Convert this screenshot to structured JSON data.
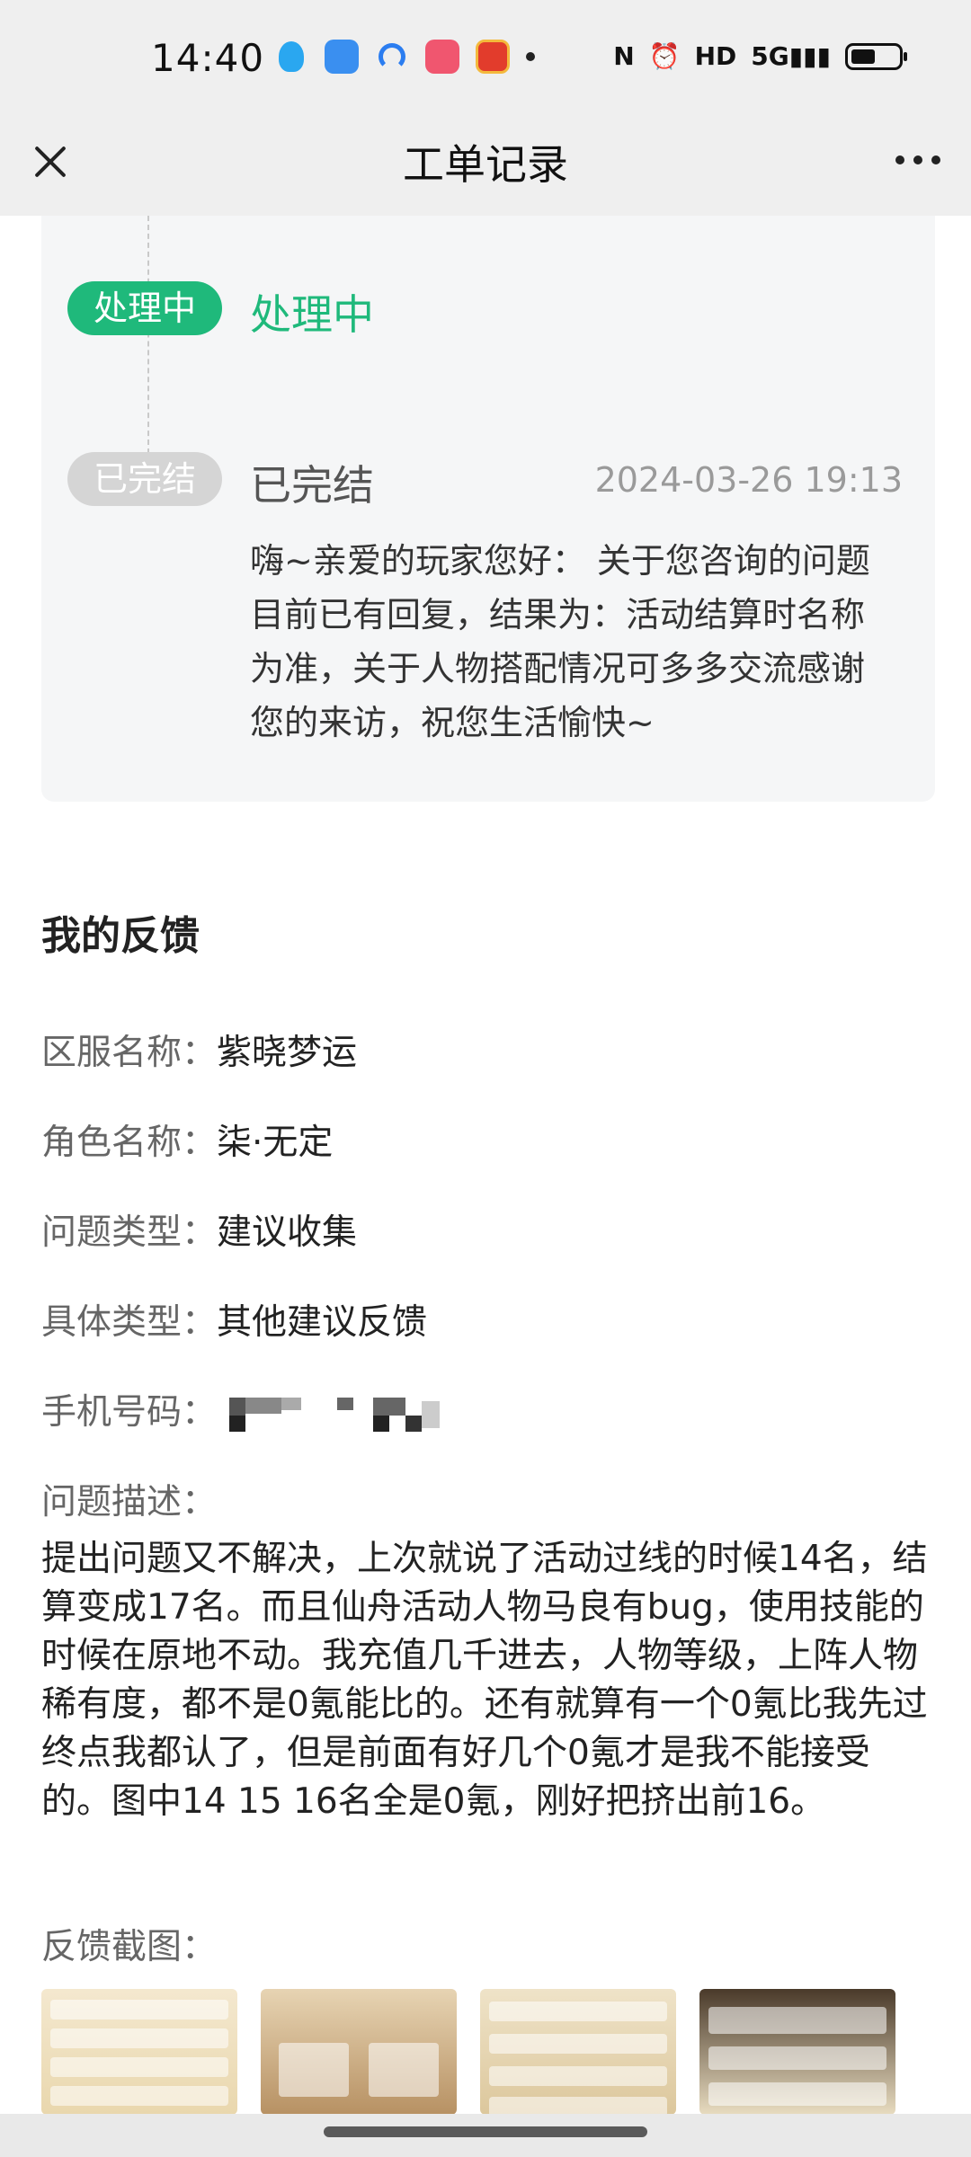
{
  "status_bar": {
    "time": "14:40",
    "notification_icons": [
      "qq-icon",
      "blue-app-icon",
      "arc-app-icon",
      "bilibili-icon",
      "game-app-icon"
    ],
    "system_icons": [
      "nfc-icon",
      "alarm-icon",
      "hd-icon",
      "signal-5g-icon",
      "battery-icon"
    ],
    "hd_label": "HD",
    "nfc_label": "N",
    "signal_label": "5G"
  },
  "header": {
    "title": "工单记录"
  },
  "timeline": {
    "steps": [
      {
        "badge": "处理中",
        "title": "处理中"
      },
      {
        "badge": "已完结",
        "title": "已完结",
        "time": "2024-03-26 19:13",
        "message": "嗨~亲爱的玩家您好： 关于您咨询的问题目前已有回复，结果为：活动结算时名称为准，关于人物搭配情况可多多交流感谢您的来访，祝您生活愉快~"
      }
    ]
  },
  "feedback": {
    "section_title": "我的反馈",
    "fields": [
      {
        "label": "区服名称：",
        "value": "紫晓梦运"
      },
      {
        "label": "角色名称：",
        "value": "柒·无定"
      },
      {
        "label": "问题类型：",
        "value": "建议收集"
      },
      {
        "label": "具体类型：",
        "value": "其他建议反馈"
      },
      {
        "label": "手机号码：",
        "value": ""
      }
    ],
    "description_label": "问题描述：",
    "description": "提出问题又不解决，上次就说了活动过线的时候14名，结算变成17名。而且仙舟活动人物马良有bug，使用技能的时候在原地不动。我充值几千进去，人物等级，上阵人物稀有度，都不是0氪能比的。还有就算有一个0氪比我先过终点我都认了，但是前面有好几个0氪才是我不能接受的。图中14 15 16名全是0氪，刚好把挤出前16。",
    "screenshots_label": "反馈截图："
  },
  "colors": {
    "accent_green": "#1fb97b",
    "badge_gray": "#d5d5d5",
    "card_bg": "#f5f6f7"
  }
}
